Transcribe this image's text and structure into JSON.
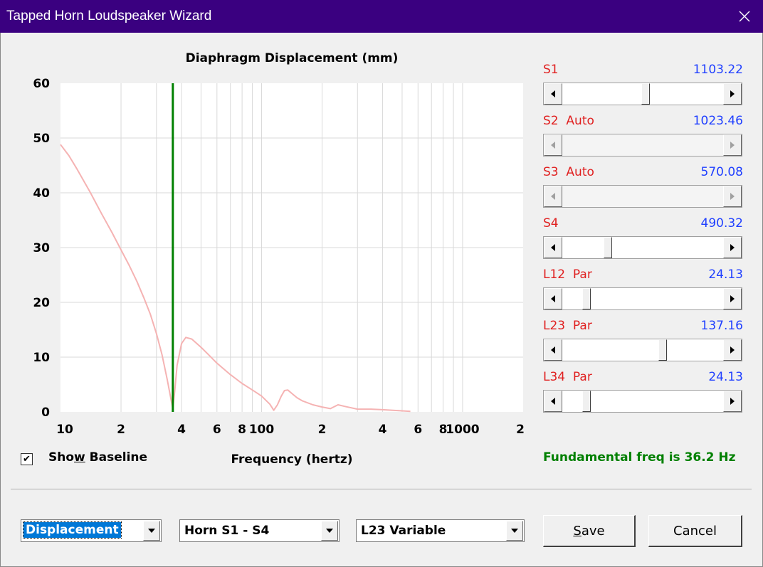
{
  "window": {
    "title": "Tapped Horn Loudspeaker Wizard"
  },
  "chart_data": {
    "type": "line",
    "title": "Diaphragm Displacement (mm)",
    "xlabel": "Frequency (hertz)",
    "ylabel": "",
    "x_scale": "log",
    "xlim": [
      10,
      2000
    ],
    "ylim": [
      0,
      60
    ],
    "y_ticks": [
      0,
      10,
      20,
      30,
      40,
      50,
      60
    ],
    "x_tick_labels": [
      "10",
      "2",
      "4",
      "6",
      "8",
      "100",
      "2",
      "4",
      "6",
      "8",
      "1000",
      "2"
    ],
    "grid": true,
    "series": [
      {
        "color": "#f5b3b3",
        "x": [
          10,
          11,
          12,
          14,
          16,
          18,
          20,
          22,
          24,
          26,
          28,
          30,
          32,
          34,
          35.5,
          36.2,
          37,
          38,
          40,
          42,
          45,
          50,
          55,
          60,
          70,
          80,
          90,
          100,
          110,
          115,
          120,
          125,
          130,
          135,
          140,
          150,
          160,
          180,
          200,
          220,
          240,
          260,
          300,
          350,
          400,
          450,
          500,
          550
        ],
        "y": [
          48.8,
          46.8,
          44.5,
          40.2,
          36.2,
          32.8,
          29.6,
          26.7,
          23.8,
          20.8,
          17.8,
          14.3,
          10.4,
          5.8,
          2.2,
          0.6,
          3.8,
          8.5,
          12.5,
          13.6,
          13.3,
          11.8,
          10.3,
          8.9,
          6.8,
          5.2,
          4.0,
          2.9,
          1.4,
          0.3,
          1.3,
          2.8,
          3.9,
          4.0,
          3.5,
          2.6,
          2.0,
          1.3,
          0.9,
          0.6,
          1.3,
          1.0,
          0.5,
          0.5,
          0.4,
          0.3,
          0.2,
          0.1
        ]
      }
    ],
    "marker_line": {
      "x": 36.2,
      "color": "#008000"
    }
  },
  "controls": {
    "show_baseline": {
      "label_pre": "Sho",
      "label_accel": "w",
      "label_post": " Baseline",
      "checked": true,
      "check_glyph": "✔"
    },
    "fundamental_text": "Fundamental freq is 36.2 Hz",
    "fundamental_color": "#008000"
  },
  "sliders": [
    {
      "name": "S1",
      "value": "1103.22",
      "position": 0.52,
      "enabled": true
    },
    {
      "name": "S2  Auto",
      "value": "1023.46",
      "position": null,
      "enabled": false
    },
    {
      "name": "S3  Auto",
      "value": "570.08",
      "position": null,
      "enabled": false
    },
    {
      "name": "S4",
      "value": "490.32",
      "position": 0.27,
      "enabled": true
    },
    {
      "name": "L12  Par",
      "value": "24.13",
      "position": 0.13,
      "enabled": true
    },
    {
      "name": "L23  Par",
      "value": "137.16",
      "position": 0.63,
      "enabled": true
    },
    {
      "name": "L34  Par",
      "value": "24.13",
      "position": 0.13,
      "enabled": true
    }
  ],
  "bottom": {
    "mode_select": "Displacement",
    "horn_select": "Horn S1 - S4",
    "variable_select": "L23 Variable",
    "save_pre": "",
    "save_accel": "S",
    "save_post": "ave",
    "cancel_label": "Cancel"
  },
  "colors": {
    "title_bar": "#3a0080",
    "slider_name": "#e02020",
    "slider_value": "#2040ff",
    "selection": "#0078d7"
  }
}
